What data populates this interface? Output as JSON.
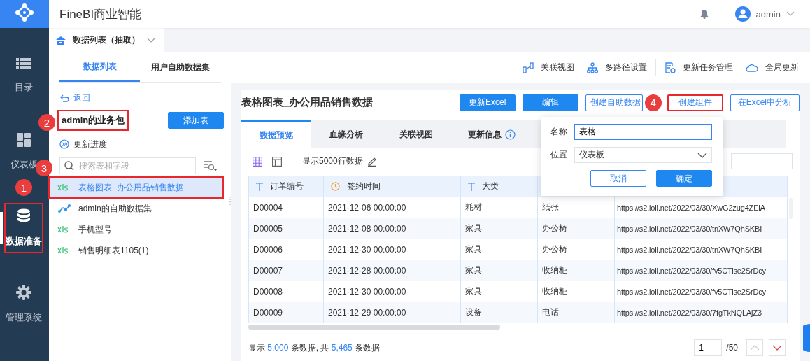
{
  "app": {
    "title": "FineBI商业智能",
    "user": "admin"
  },
  "sidebar": {
    "items": [
      {
        "label": "目录",
        "selected": false
      },
      {
        "label": "仪表板",
        "selected": false
      },
      {
        "label": "数据准备",
        "selected": true,
        "highlighted": true,
        "annotation": "1"
      },
      {
        "label": "管理系统",
        "selected": false
      }
    ]
  },
  "breadcrumb_tab": {
    "label": "数据列表（抽取）"
  },
  "panel_tabs": [
    {
      "label": "数据列表",
      "selected": true
    },
    {
      "label": "用户自助数据集",
      "selected": false
    }
  ],
  "toolbar": [
    {
      "label": "关联视图"
    },
    {
      "label": "多路径设置"
    },
    {
      "label": "更新任务管理"
    },
    {
      "label": "全局更新"
    }
  ],
  "left_panel": {
    "back": "返回",
    "package": {
      "title": "admin的业务包",
      "highlighted": true,
      "annotation": "2"
    },
    "add_button": "添加表",
    "progress": "更新进度",
    "search": {
      "placeholder": "搜索表和字段"
    },
    "tables": [
      {
        "name": "表格图表_办公用品销售数据",
        "kind": "xls",
        "selected": true,
        "highlighted": true,
        "annotation": "3"
      },
      {
        "name": "admin的自助数据集",
        "kind": "dataset",
        "selected": false
      },
      {
        "name": "手机型号",
        "kind": "xls",
        "selected": false
      },
      {
        "name": "销售明细表1105(1)",
        "kind": "xls",
        "selected": false
      }
    ]
  },
  "detail": {
    "title": "表格图表_办公用品销售数据",
    "buttons": [
      {
        "label": "更新Excel",
        "kind": "primary"
      },
      {
        "label": "编辑",
        "kind": "primary"
      },
      {
        "label": "创建自助数据",
        "kind": "outline"
      },
      {
        "label": "创建组件",
        "kind": "outline",
        "highlighted": true,
        "annotation": "4"
      },
      {
        "label": "在Excel中分析",
        "kind": "outline"
      }
    ],
    "tabs": [
      {
        "label": "数据预览",
        "selected": true
      },
      {
        "label": "血缘分析",
        "selected": false
      },
      {
        "label": "关联视图",
        "selected": false
      },
      {
        "label": "更新信息",
        "selected": false,
        "info": true
      }
    ],
    "row_limit": "显示5000行数据",
    "table": {
      "columns": [
        {
          "label": "订单编号",
          "kind": "text"
        },
        {
          "label": "签约时间",
          "kind": "date"
        },
        {
          "label": "大类",
          "kind": "text"
        }
      ],
      "rows": [
        [
          "D00004",
          "2021-12-06 00:00:00",
          "耗材",
          "纸张",
          "https://s2.loli.net/2022/03/30/XwG2zug4ZEiA"
        ],
        [
          "D00005",
          "2021-12-08 00:00:00",
          "家具",
          "办公椅",
          "https://s2.loli.net/2022/03/30/tnXW7QhSKBI"
        ],
        [
          "D00006",
          "2021-12-30 00:00:00",
          "家具",
          "办公椅",
          "https://s2.loli.net/2022/03/30/tnXW7QhSKBI"
        ],
        [
          "D00007",
          "2021-12-28 00:00:00",
          "家具",
          "收纳柜",
          "https://s2.loli.net/2022/03/30/fv5CTise2SrDcy"
        ],
        [
          "D00008",
          "2021-12-30 00:00:00",
          "家具",
          "收纳柜",
          "https://s2.loli.net/2022/03/30/fv5CTise2SrDcy"
        ],
        [
          "D00009",
          "2021-12-29 00:00:00",
          "设备",
          "电话",
          "https://s2.loli.net/2022/03/30/7fgTkNQLAjZ3"
        ]
      ]
    },
    "summary": [
      {
        "text": "显示 "
      },
      {
        "text": "5,000",
        "highlight": true
      },
      {
        "text": " 条数据, 共 "
      },
      {
        "text": "5,465",
        "highlight": true
      },
      {
        "text": " 条数据"
      }
    ],
    "pagination": {
      "page": "1",
      "total": "/50"
    },
    "popover": {
      "name_label": "名称",
      "name_value": "表格",
      "location_label": "位置",
      "location_value": "仪表板",
      "cancel": "取消",
      "confirm": "确定"
    }
  }
}
